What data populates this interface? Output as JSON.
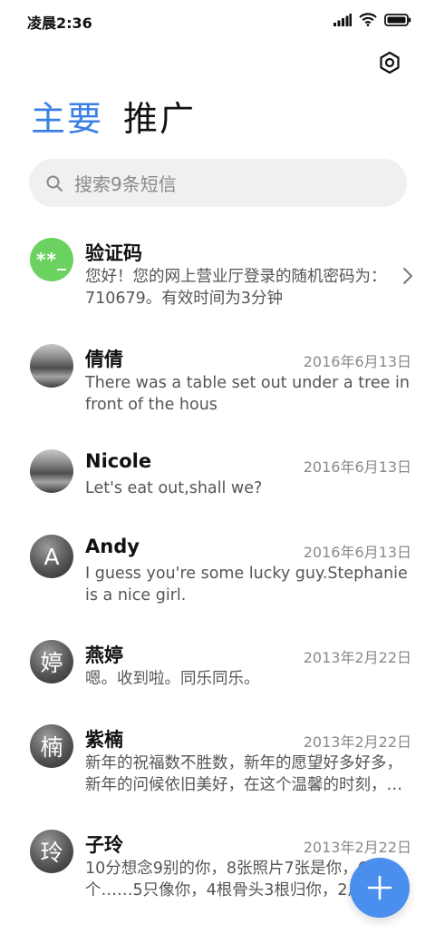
{
  "status_bar": {
    "time": "凌晨2:36"
  },
  "tabs": [
    {
      "label": "主要",
      "active": true
    },
    {
      "label": "推广",
      "active": false
    }
  ],
  "search": {
    "placeholder": "搜索9条短信"
  },
  "conversations": [
    {
      "avatar": "**_",
      "name": "验证码",
      "date": "",
      "preview": "您好！您的网上营业厅登录的随机密码为：710679。有效时间为3分钟"
    },
    {
      "avatar": "",
      "name": "倩倩",
      "date": "2016年6月13日",
      "preview": "There was a table set out under a tree in front of the hous"
    },
    {
      "avatar": "",
      "name": "Nicole",
      "date": "2016年6月13日",
      "preview": "Let's eat out,shall we?"
    },
    {
      "avatar": "A",
      "name": "Andy",
      "date": "2016年6月13日",
      "preview": "I guess you're some lucky guy.Stephanie is a nice girl."
    },
    {
      "avatar": "婷",
      "name": "燕婷",
      "date": "2013年2月22日",
      "preview": "嗯。收到啦。同乐同乐。"
    },
    {
      "avatar": "楠",
      "name": "紫楠",
      "date": "2013年2月22日",
      "preview": "新年的祝福数不胜数，新年的愿望好多好多，新年的问候依旧美好，在这个温馨的时刻，…"
    },
    {
      "avatar": "玲",
      "name": "子玲",
      "date": "2013年2月22日",
      "preview": "10分想念9别的你，8张照片7张是你，6个……5只像你，4根骨头3根归你，2爪着地1…"
    }
  ],
  "colors": {
    "accent": "#3a7fe3",
    "fab": "#4a8fee",
    "code_avatar": "#6bd260"
  },
  "icons": {
    "settings": "settings-icon",
    "search": "search-icon",
    "compose": "plus-icon",
    "open": "chevron-right-icon"
  }
}
